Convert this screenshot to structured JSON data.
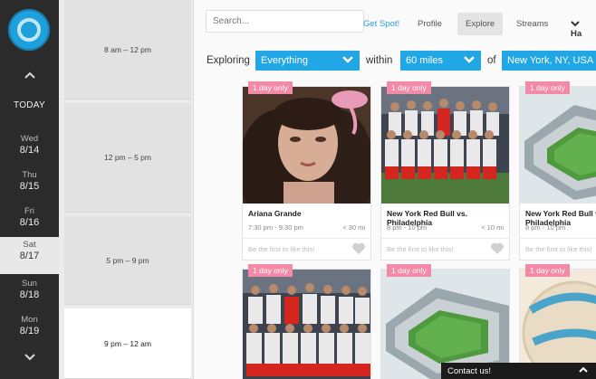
{
  "app": {
    "brand_color": "#1ea0dc",
    "accent_color": "#21a7e6",
    "badge_color": "#f28aa8"
  },
  "rail": {
    "up_icon": "chevron-up-icon",
    "down_icon": "chevron-down-icon",
    "today_label": "TODAY",
    "days": [
      {
        "dow": "Wed",
        "date": "8/14"
      },
      {
        "dow": "Thu",
        "date": "8/15"
      },
      {
        "dow": "Fri",
        "date": "8/16"
      },
      {
        "dow": "Sat",
        "date": "8/17"
      },
      {
        "dow": "Sun",
        "date": "8/18"
      },
      {
        "dow": "Mon",
        "date": "8/19"
      }
    ],
    "selected_day": "Sat 8/17"
  },
  "slots": [
    {
      "label": "8 am – 12 pm"
    },
    {
      "label": "12 pm – 5 pm"
    },
    {
      "label": "5 pm – 9 pm"
    },
    {
      "label": "9 pm – 12 am"
    }
  ],
  "topnav": {
    "search_placeholder": "Search...",
    "get_spot": "Get Spot!",
    "profile": "Profile",
    "explore": "Explore",
    "streams": "Streams",
    "user_partial": "Ha"
  },
  "explore": {
    "label": "Exploring",
    "category": "Everything",
    "within_label": "within",
    "distance": "60 miles",
    "of_label": "of",
    "location": "New York, NY, USA"
  },
  "cards": [
    {
      "badge": "1 day only",
      "title": "Ariana Grande",
      "time": "7:30 pm - 9:30 pm",
      "distance": "< 30 mi",
      "like_text": "Be the first to like this!"
    },
    {
      "badge": "1 day only",
      "title": "New York Red Bull vs. Philadelphia",
      "time": "8 pm - 10 pm",
      "distance": "< 10 mi",
      "like_text": "Be the first to like this!"
    },
    {
      "badge": "1 day only",
      "title": "New York Red Bull vs. Philadelphia",
      "time": "8 pm - 10 pm",
      "distance": "",
      "like_text": "Be the first to like this!"
    },
    {
      "badge": "1 day only"
    },
    {
      "badge": "1 day only"
    },
    {
      "badge": "1 day only"
    }
  ],
  "contact": {
    "label": "Contact us!"
  }
}
